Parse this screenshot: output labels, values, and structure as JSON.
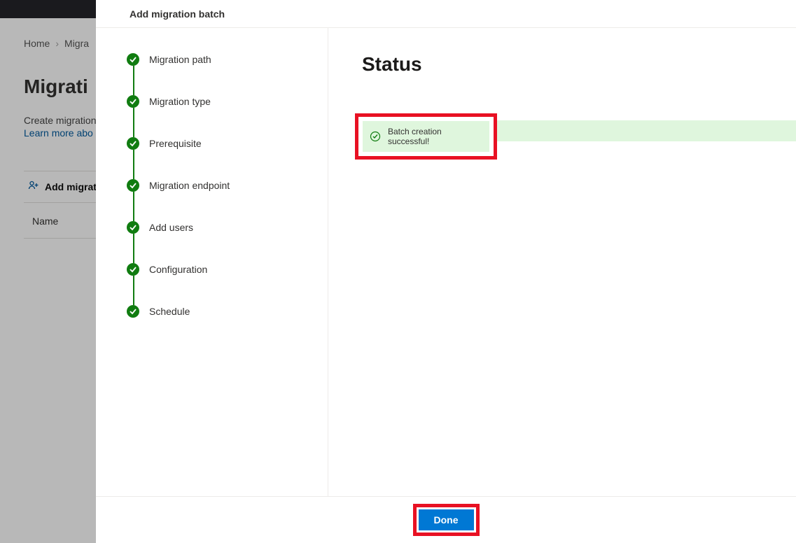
{
  "background": {
    "breadcrumb": {
      "home": "Home",
      "current": "Migra"
    },
    "heading": "Migrati",
    "desc": "Create migration",
    "learn": "Learn more abo",
    "toolbar_btn": "Add migrat",
    "table_col_name": "Name"
  },
  "modal": {
    "header_title": "Add migration batch",
    "status_heading": "Status",
    "success_message": "Batch creation successful!",
    "footer_button": "Done"
  },
  "steps": {
    "s0": "Migration path",
    "s1": "Migration type",
    "s2": "Prerequisite",
    "s3": "Migration endpoint",
    "s4": "Add users",
    "s5": "Configuration",
    "s6": "Schedule"
  }
}
